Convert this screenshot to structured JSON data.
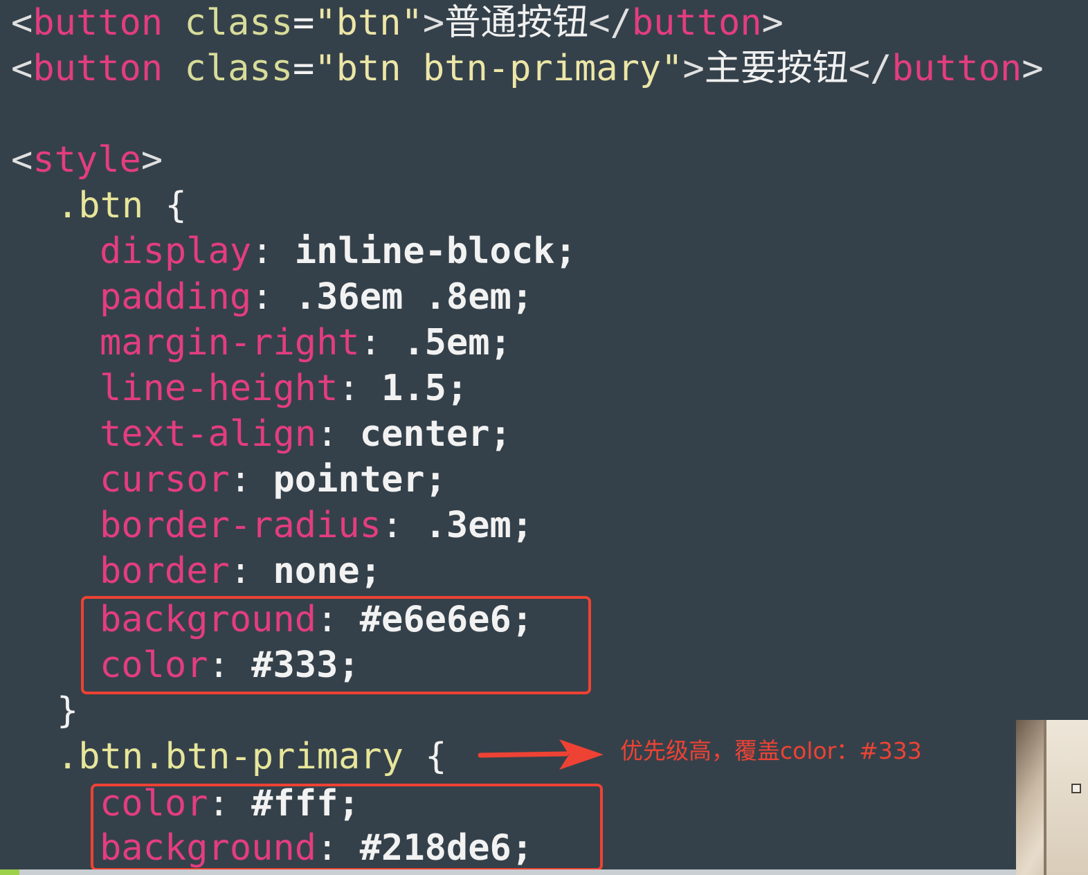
{
  "code": {
    "line1": {
      "lt": "<",
      "tag": "button",
      "sp": " ",
      "attr": "class",
      "eq": "=",
      "str": "\"btn\"",
      "gt": ">",
      "text": "普通按钮",
      "close_lt": "</",
      "close_tag": "button",
      "close_gt": ">"
    },
    "line2": {
      "lt": "<",
      "tag": "button",
      "sp": " ",
      "attr": "class",
      "eq": "=",
      "str": "\"btn btn-primary\"",
      "gt": ">",
      "text": "主要按钮",
      "close_lt": "</",
      "close_tag": "button",
      "close_gt": ">"
    },
    "style_open": {
      "lt": "<",
      "tag": "style",
      "gt": ">"
    },
    "btn_selector": ".btn",
    "brace_open": "{",
    "brace_close": "}",
    "btn_rules": [
      {
        "prop": "display",
        "colon": ": ",
        "value": "inline-block;"
      },
      {
        "prop": "padding",
        "colon": ": ",
        "value": ".36em .8em;"
      },
      {
        "prop": "margin-right",
        "colon": ": ",
        "value": ".5em;"
      },
      {
        "prop": "line-height",
        "colon": ": ",
        "value": "1.5;"
      },
      {
        "prop": "text-align",
        "colon": ": ",
        "value": "center;"
      },
      {
        "prop": "cursor",
        "colon": ": ",
        "value": "pointer;"
      },
      {
        "prop": "border-radius",
        "colon": ": ",
        "value": ".3em;"
      },
      {
        "prop": "border",
        "colon": ": ",
        "value": "none;"
      },
      {
        "prop": "background",
        "colon": ": ",
        "value": "#e6e6e6;"
      },
      {
        "prop": "color",
        "colon": ": ",
        "value": "#333;"
      }
    ],
    "primary_selector": ".btn.btn-primary",
    "primary_rules": [
      {
        "prop": "color",
        "colon": ": ",
        "value": "#fff;"
      },
      {
        "prop": "background",
        "colon": ": ",
        "value": "#218de6;"
      }
    ]
  },
  "annotation": {
    "note": "优先级高，覆盖color：#333",
    "color": "#ee4234"
  },
  "theme": {
    "background": "#35414a",
    "tag_name": "#e43d7f",
    "property": "#e43d7f",
    "selector": "#e7e69a",
    "string": "#ece6a7"
  }
}
